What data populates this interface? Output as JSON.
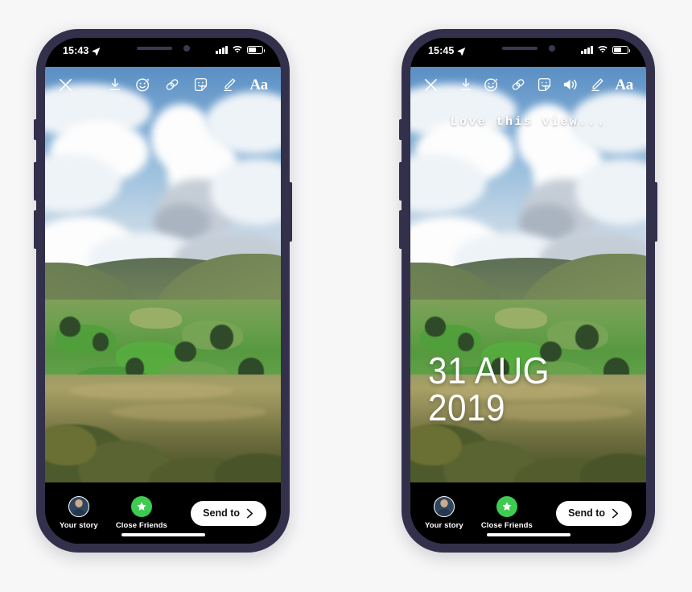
{
  "scene": {
    "background_color": "#f7f7f8",
    "phone_frame_color": "#32304b",
    "accent_green": "#3dcb50",
    "send_button_bg": "#ffffff"
  },
  "phones": [
    {
      "id": "phone-left",
      "status_bar": {
        "time": "15:43",
        "location_icon": "location-arrow-icon",
        "signal_icon": "cellular-signal-icon",
        "wifi_icon": "wifi-icon",
        "battery_icon": "battery-icon"
      },
      "toolbar": {
        "close_label": "close-icon",
        "items": [
          {
            "name": "download-icon",
            "label": "Save"
          },
          {
            "name": "effects-icon",
            "label": "Effects"
          },
          {
            "name": "link-icon",
            "label": "Link"
          },
          {
            "name": "sticker-icon",
            "label": "Stickers"
          },
          {
            "name": "draw-icon",
            "label": "Draw"
          },
          {
            "name": "text-icon",
            "label": "Aa"
          }
        ]
      },
      "overlays": {
        "caption": "",
        "date": ""
      },
      "bottom_bar": {
        "your_story_label": "Your story",
        "close_friends_label": "Close Friends",
        "send_to_label": "Send to",
        "chevron_icon": "chevron-right-icon"
      }
    },
    {
      "id": "phone-right",
      "status_bar": {
        "time": "15:45",
        "location_icon": "location-arrow-icon",
        "signal_icon": "cellular-signal-icon",
        "wifi_icon": "wifi-icon",
        "battery_icon": "battery-icon"
      },
      "toolbar": {
        "close_label": "close-icon",
        "items": [
          {
            "name": "download-icon",
            "label": "Save"
          },
          {
            "name": "effects-icon",
            "label": "Effects"
          },
          {
            "name": "link-icon",
            "label": "Link"
          },
          {
            "name": "sticker-icon",
            "label": "Stickers"
          },
          {
            "name": "sound-icon",
            "label": "Sound"
          },
          {
            "name": "draw-icon",
            "label": "Draw"
          },
          {
            "name": "text-icon",
            "label": "Aa"
          }
        ]
      },
      "overlays": {
        "caption": "Love this view...",
        "date": "31 AUG 2019"
      },
      "bottom_bar": {
        "your_story_label": "Your story",
        "close_friends_label": "Close Friends",
        "send_to_label": "Send to",
        "chevron_icon": "chevron-right-icon"
      }
    }
  ],
  "photo": {
    "description": "Green rolling valley landscape with cumulus clouds, farmland fields, farmhouse and gorse in foreground"
  }
}
